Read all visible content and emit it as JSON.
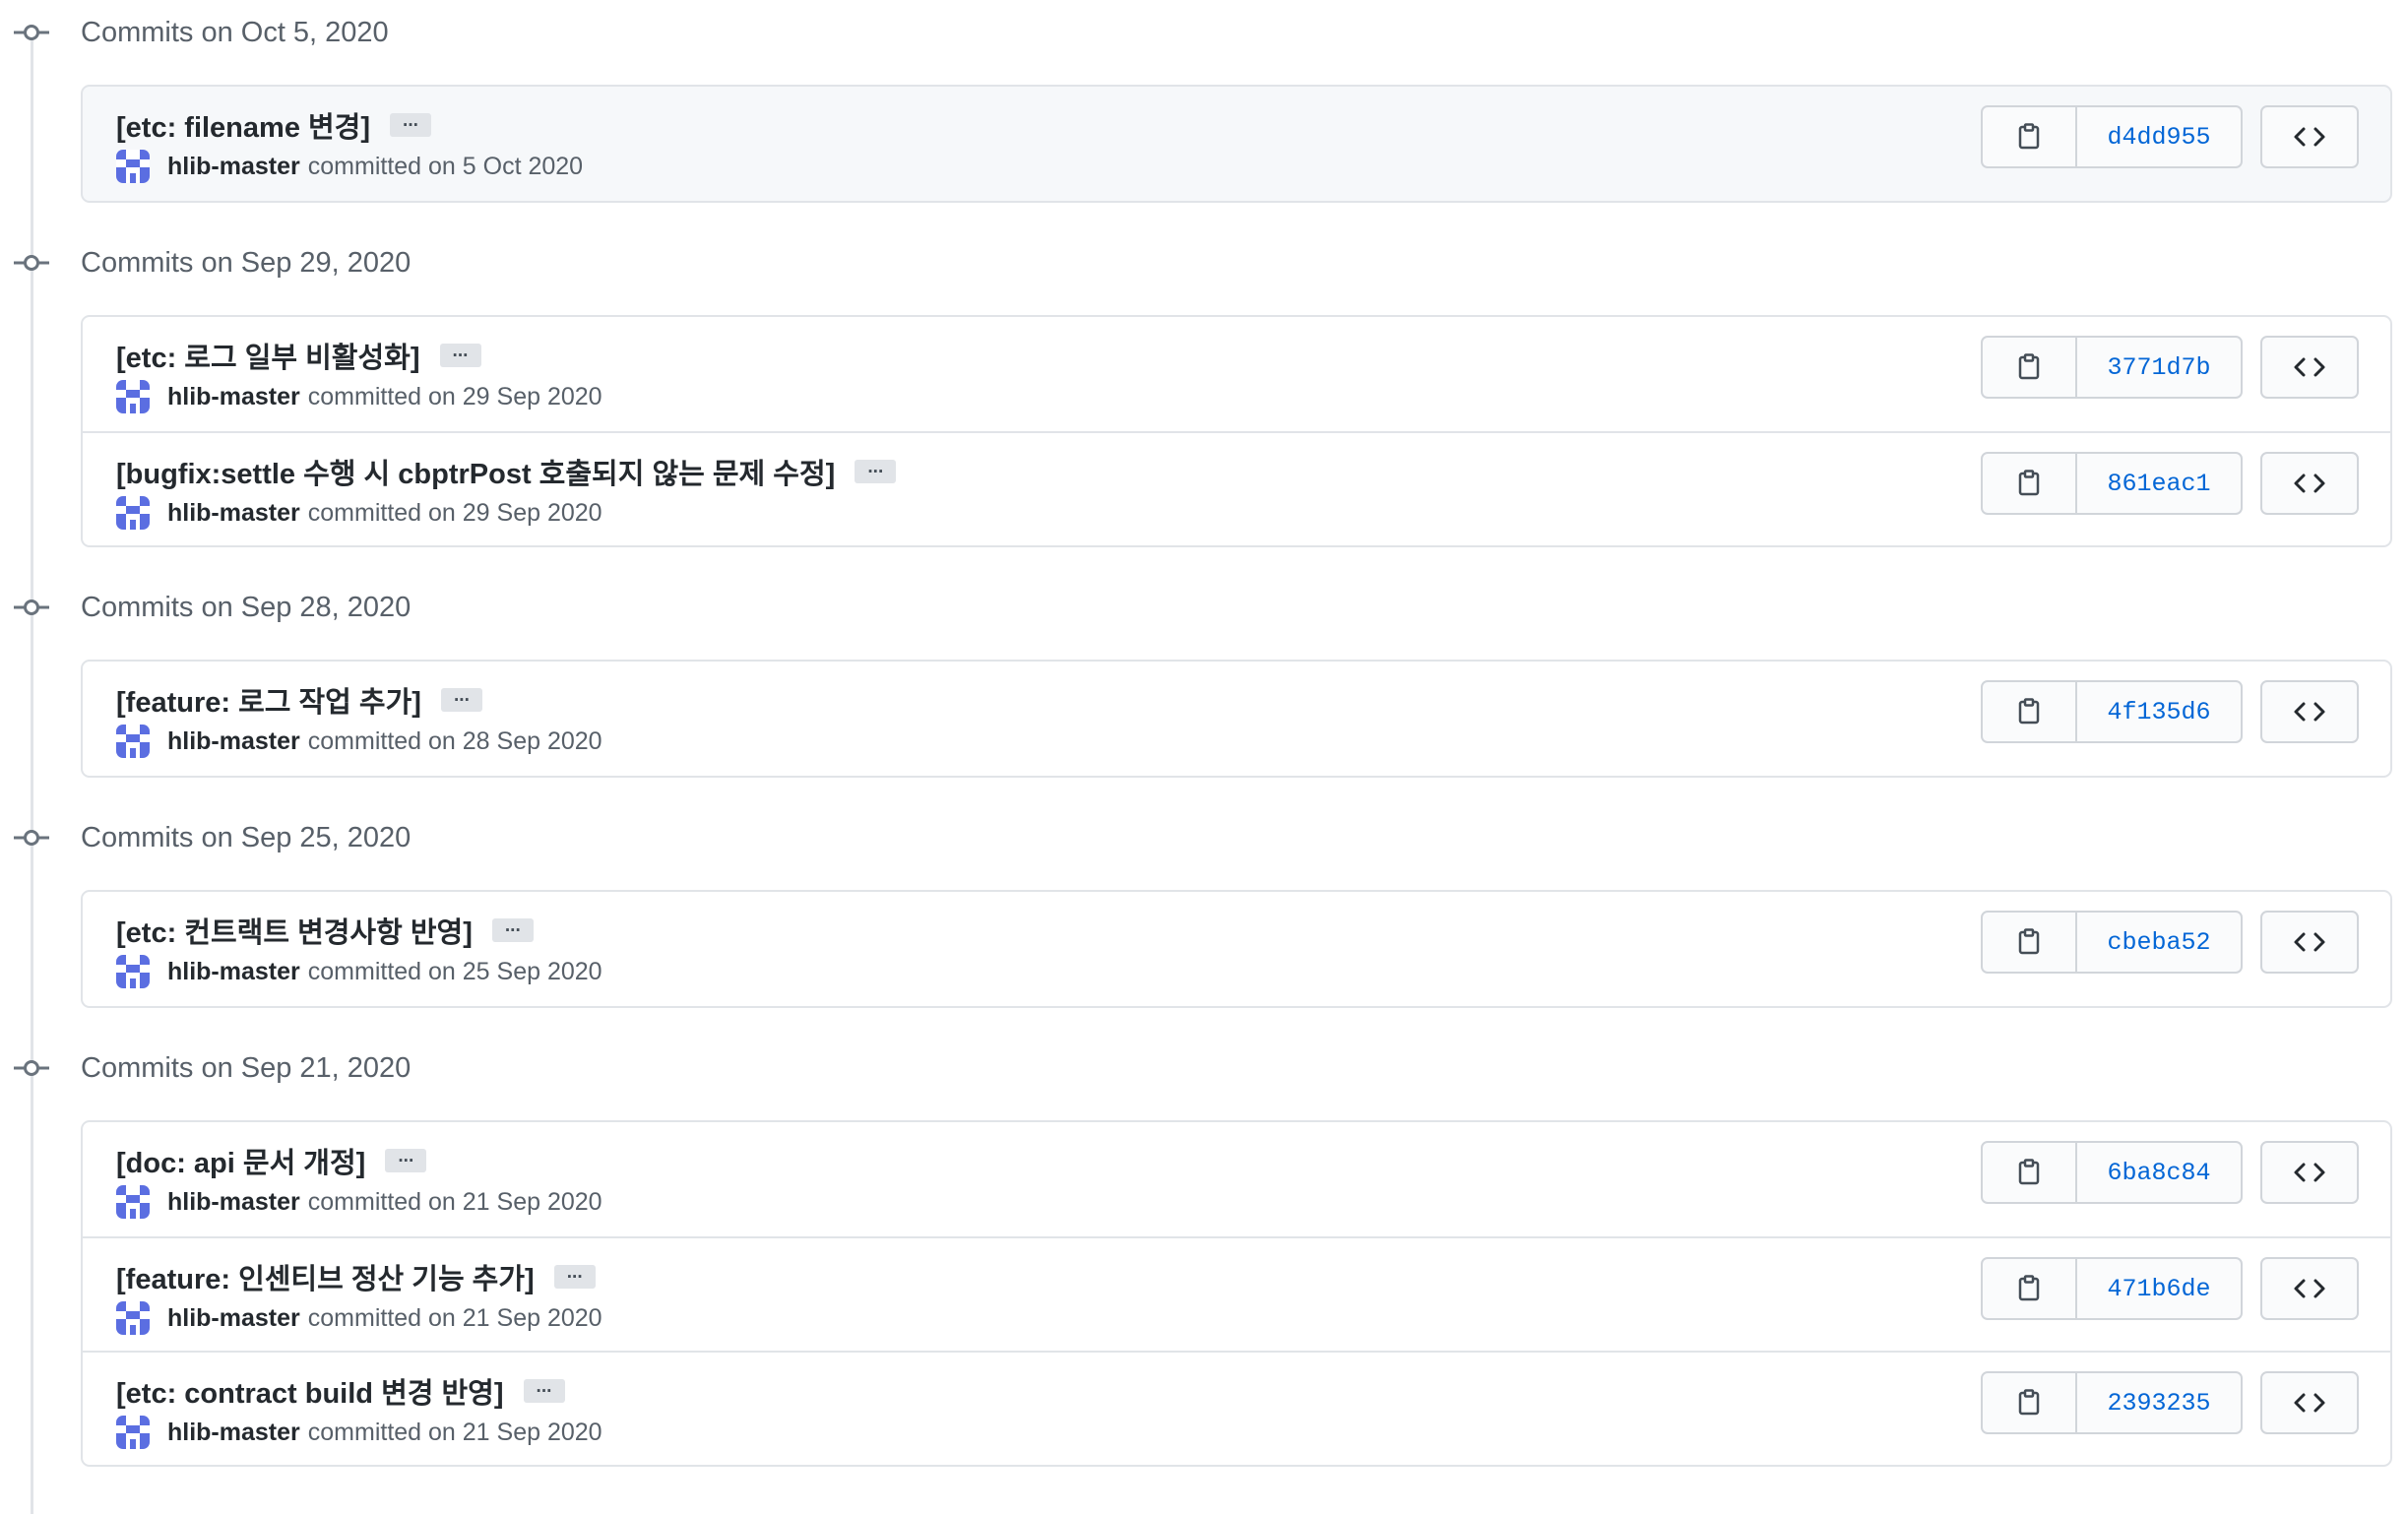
{
  "theme": {
    "border": "#e1e4e8",
    "muted_text": "#586069",
    "link": "#0366d6",
    "avatar_primary": "#5b6ee1",
    "avatar_secondary": "#ffffff"
  },
  "icons": {
    "timeline_node": "git-commit-icon",
    "copy": "clipboard-icon",
    "browse": "code-icon",
    "more": "ellipsis-icon"
  },
  "commit_groups": [
    {
      "title": "Commits on Oct 5, 2020",
      "commits": [
        {
          "message": "[etc: filename 변경]",
          "more": "···",
          "author": "hlib-master",
          "committed_text": "committed on 5 Oct 2020",
          "sha": "d4dd955"
        }
      ]
    },
    {
      "title": "Commits on Sep 29, 2020",
      "commits": [
        {
          "message": "[etc: 로그 일부 비활성화]",
          "more": "···",
          "author": "hlib-master",
          "committed_text": "committed on 29 Sep 2020",
          "sha": "3771d7b"
        },
        {
          "message": "[bugfix:settle 수행 시 cbptrPost 호출되지 않는 문제 수정]",
          "more": "···",
          "author": "hlib-master",
          "committed_text": "committed on 29 Sep 2020",
          "sha": "861eac1"
        }
      ]
    },
    {
      "title": "Commits on Sep 28, 2020",
      "commits": [
        {
          "message": "[feature: 로그 작업 추가]",
          "more": "···",
          "author": "hlib-master",
          "committed_text": "committed on 28 Sep 2020",
          "sha": "4f135d6"
        }
      ]
    },
    {
      "title": "Commits on Sep 25, 2020",
      "commits": [
        {
          "message": "[etc: 컨트랙트 변경사항 반영]",
          "more": "···",
          "author": "hlib-master",
          "committed_text": "committed on 25 Sep 2020",
          "sha": "cbeba52"
        }
      ]
    },
    {
      "title": "Commits on Sep 21, 2020",
      "commits": [
        {
          "message": "[doc: api 문서 개정]",
          "more": "···",
          "author": "hlib-master",
          "committed_text": "committed on 21 Sep 2020",
          "sha": "6ba8c84"
        },
        {
          "message": "[feature: 인센티브 정산 기능 추가]",
          "more": "···",
          "author": "hlib-master",
          "committed_text": "committed on 21 Sep 2020",
          "sha": "471b6de"
        },
        {
          "message": "[etc: contract build 변경 반영]",
          "more": "···",
          "author": "hlib-master",
          "committed_text": "committed on 21 Sep 2020",
          "sha": "2393235"
        }
      ]
    }
  ]
}
